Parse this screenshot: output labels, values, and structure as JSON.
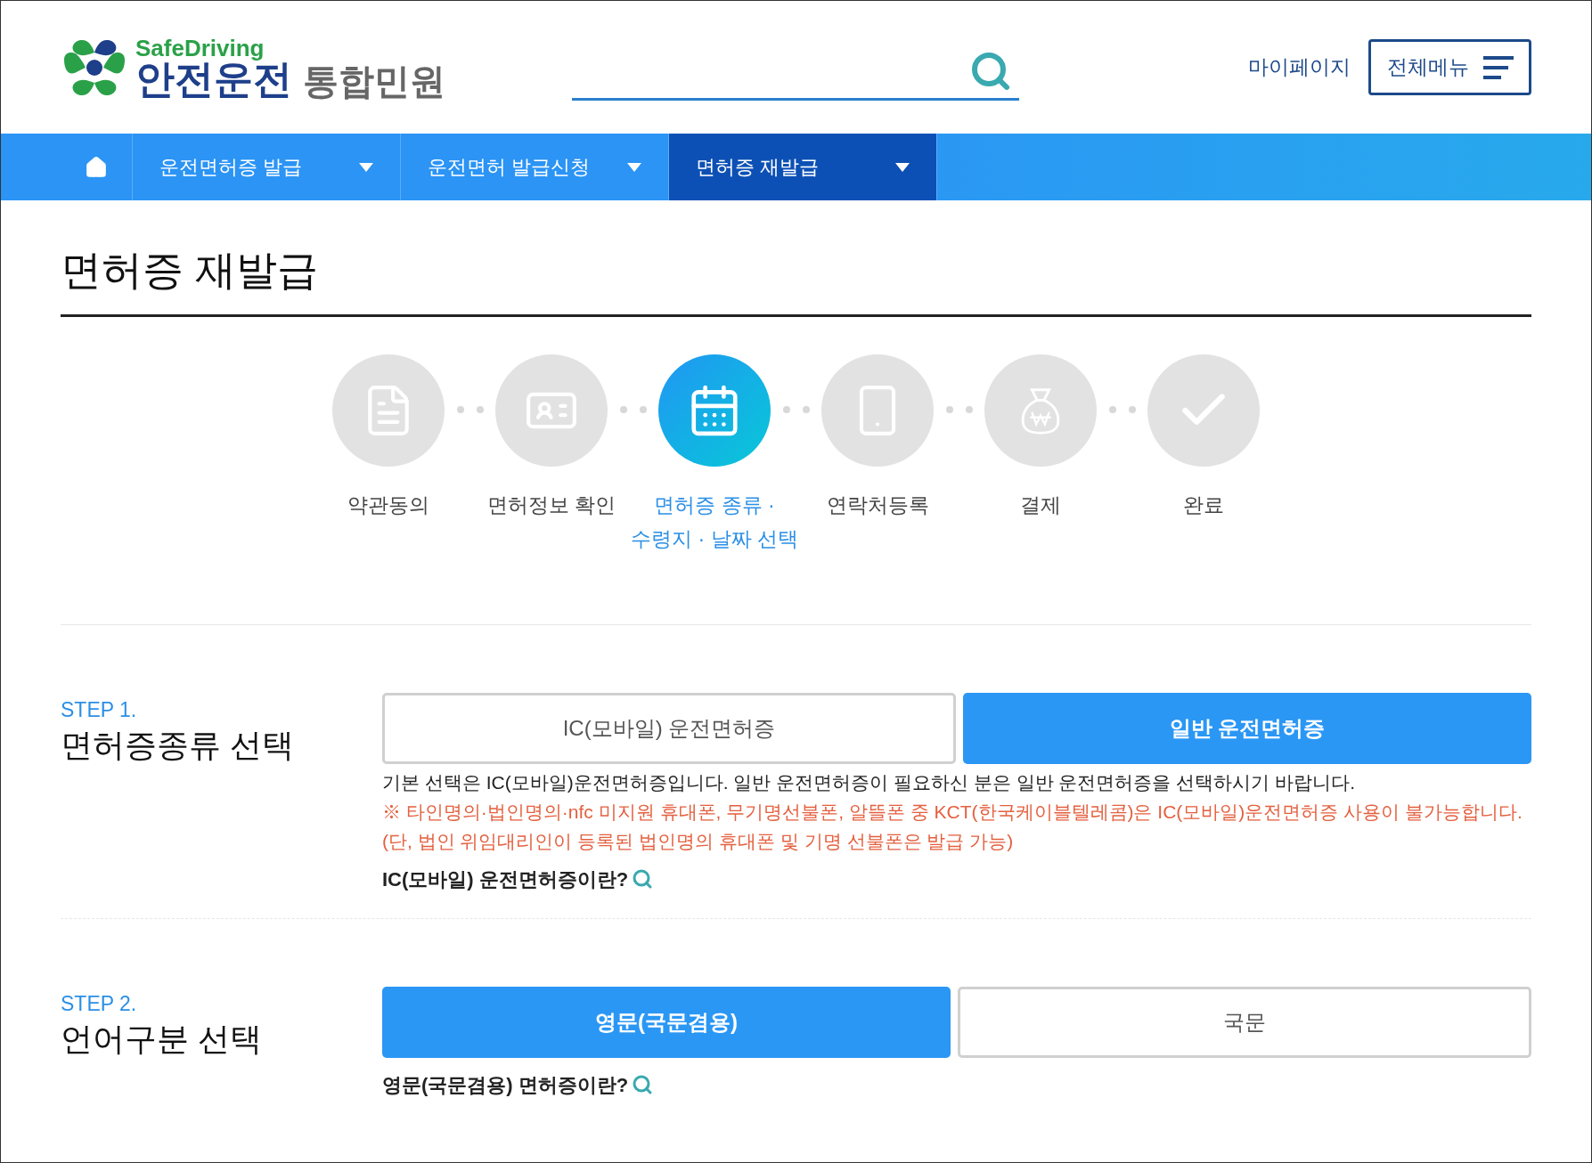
{
  "header": {
    "logo_top": "SafeDriving",
    "logo_main": "안전운전",
    "logo_sub": "통합민원",
    "mypage": "마이페이지",
    "menu_button": "전체메뉴"
  },
  "nav": [
    {
      "label": "운전면허증 발급",
      "selected": false
    },
    {
      "label": "운전면허 발급신청",
      "selected": false
    },
    {
      "label": "면허증 재발급",
      "selected": true
    }
  ],
  "page_title": "면허증 재발급",
  "steps": [
    {
      "kind": "document",
      "label": "약관동의",
      "selected": false
    },
    {
      "kind": "idcard",
      "label": "면허정보 확인",
      "selected": false
    },
    {
      "kind": "calendar",
      "label": "면허증 종류 · 수령지 · 날짜 선택",
      "selected": true
    },
    {
      "kind": "phone",
      "label": "연락처등록",
      "selected": false
    },
    {
      "kind": "money",
      "label": "결제",
      "selected": false
    },
    {
      "kind": "check",
      "label": "완료",
      "selected": false
    }
  ],
  "sections": [
    {
      "step": "STEP 1.",
      "title": "면허증종류 선택",
      "options": [
        {
          "label": "IC(모바일) 운전면허증",
          "selected": false
        },
        {
          "label": "일반 운전면허증",
          "selected": true
        }
      ],
      "notes": [
        {
          "kind": "plain",
          "text": "기본 선택은 IC(모바일)운전면허증입니다. 일반 운전면허증이 필요하신 분은 일반 운전면허증을 선택하시기 바랍니다."
        },
        {
          "kind": "warning",
          "text": "※ 타인명의·법인명의·nfc 미지원 휴대폰, 무기명선불폰, 알뜰폰 중 KCT(한국케이블텔레콤)은 IC(모바일)운전면허증 사용이 불가능합니다."
        },
        {
          "kind": "warning",
          "text": "(단, 법인 위임대리인이 등록된 법인명의 휴대폰 및 기명 선불폰은 발급 가능)"
        }
      ],
      "link": "IC(모바일) 운전면허증이란?"
    },
    {
      "step": "STEP 2.",
      "title": "언어구분 선택",
      "options": [
        {
          "label": "영문(국문겸용)",
          "selected": true
        },
        {
          "label": "국문",
          "selected": false
        }
      ],
      "link": "영문(국문겸용) 면허증이란?"
    }
  ]
}
